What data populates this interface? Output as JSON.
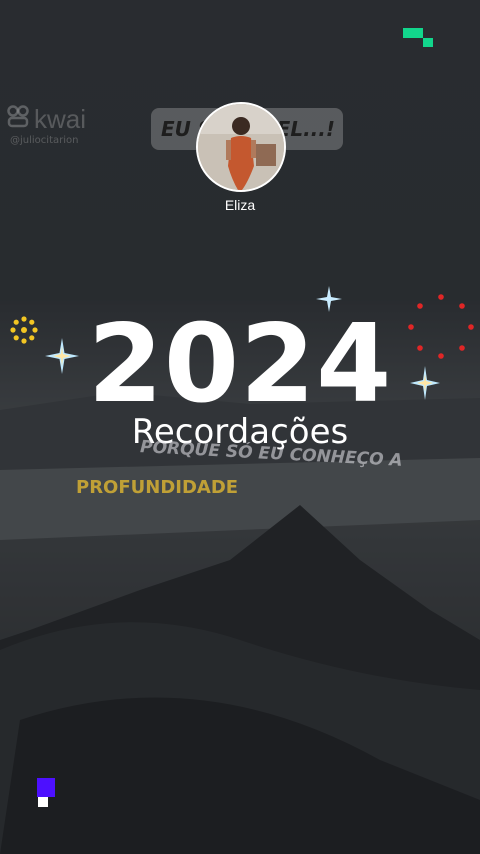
{
  "watermark": {
    "brand": "kwai",
    "handle": "@juliocitarion"
  },
  "banner": {
    "left_text": "EU S",
    "right_text": "VEL...!"
  },
  "profile": {
    "name": "Eliza"
  },
  "title": {
    "year": "2024",
    "subtitle": "Recordações"
  },
  "captions": {
    "line1": "PORQUE SÓ EU CONHEÇO A",
    "line2": "PROFUNDIDADE"
  },
  "colors": {
    "green": "#12d68c",
    "purple": "#4d10ff",
    "gold": "#f3c623",
    "red": "#e02626",
    "sparkle": "#bfe9ff"
  },
  "icons": [
    "kwai-logo-icon",
    "sparkle-icon",
    "sun-dots-icon",
    "dotted-circle-icon"
  ]
}
